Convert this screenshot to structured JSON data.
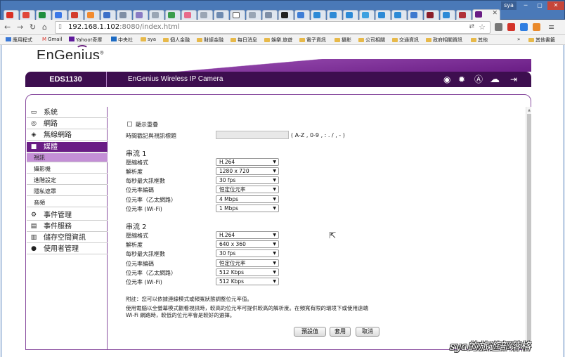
{
  "browser": {
    "window_user": "sya",
    "url_host": "192.168.1.102",
    "url_rest": ":8080/index.html",
    "bookmarks": [
      "應用程式",
      "Gmail",
      "Yahoo!奇摩",
      "中央社",
      "sya",
      "個人金融",
      "財經金融",
      "每日消息",
      "娛樂.旅遊",
      "電子資訊",
      "攝影",
      "公司相關",
      "交通資訊",
      "政府相關資訊",
      "其他",
      "其他書籤"
    ],
    "more": "»"
  },
  "app": {
    "brand": "EnGenius",
    "model": "EDS1130",
    "title": "EnGenius Wireless IP Camera"
  },
  "sidebar": {
    "items": [
      {
        "label": "系統",
        "icon": "monitor-icon"
      },
      {
        "label": "網路",
        "icon": "globe-icon"
      },
      {
        "label": "無線網路",
        "icon": "wireless-icon"
      },
      {
        "label": "媒體",
        "icon": "camera-icon"
      },
      {
        "label": "事件管理",
        "icon": "gear-search-icon"
      },
      {
        "label": "事件服務",
        "icon": "server-icon"
      },
      {
        "label": "儲存空間資訊",
        "icon": "storage-icon"
      },
      {
        "label": "使用者管理",
        "icon": "users-icon"
      }
    ],
    "subitems": [
      "視訊",
      "攝影機",
      "進階設定",
      "隱私遮罩",
      "音頻"
    ]
  },
  "form": {
    "overlay_label": "顯示重疊",
    "timestamp_label": "時間戳記與視訊標題",
    "timestamp_hint": "( A-Z , 0-9 , : . / , - )",
    "stream1": {
      "title": "串流 1",
      "fields": [
        {
          "label": "壓縮格式",
          "value": "H.264"
        },
        {
          "label": "解析度",
          "value": "1280 x 720"
        },
        {
          "label": "每秒最大訊框數",
          "value": "30 fps"
        },
        {
          "label": "位元率編碼",
          "value": "恒定位元率"
        },
        {
          "label": "位元率（乙太網路）",
          "value": "4 Mbps"
        },
        {
          "label": "位元率 (Wi-Fi)",
          "value": "1 Mbps"
        }
      ]
    },
    "stream2": {
      "title": "串流 2",
      "fields": [
        {
          "label": "壓縮格式",
          "value": "H.264"
        },
        {
          "label": "解析度",
          "value": "640 x 360"
        },
        {
          "label": "每秒最大訊框數",
          "value": "30 fps"
        },
        {
          "label": "位元率編碼",
          "value": "恒定位元率"
        },
        {
          "label": "位元率（乙太網路）",
          "value": "512 Kbps"
        },
        {
          "label": "位元率 (Wi-Fi)",
          "value": "512 Kbps"
        }
      ]
    },
    "notes": [
      "附註：您可以依據連線模式或頻寬狀態調整位元率值。",
      "使用電腦以全螢幕模式觀看視訊時，較高的位元率可提供較高的解析度。在頻寬有限的環境下或使用遠端",
      "Wi-Fi 網路時，較低的位元率會是較好的選擇。"
    ],
    "buttons": {
      "default": "預設值",
      "apply": "套用",
      "cancel": "取消"
    }
  },
  "watermark": "sya的旅遊部落格",
  "colors": {
    "brand_purple": "#6a1d85",
    "banner_dark": "#3d0e4f",
    "selected_sub": "#c48fd6"
  }
}
